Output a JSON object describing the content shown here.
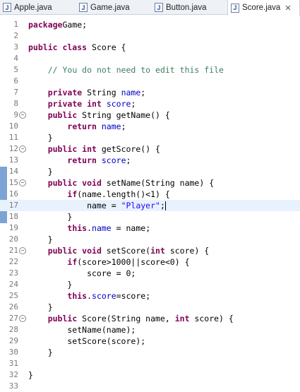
{
  "tabs": [
    {
      "label": "Apple.java",
      "active": false
    },
    {
      "label": "Game.java",
      "active": false
    },
    {
      "label": "Button.java",
      "active": false
    },
    {
      "label": "Score.java",
      "active": true
    }
  ],
  "current_line": 17,
  "lines": [
    {
      "n": "1",
      "fold": false,
      "t": [
        [
          "kw",
          "package"
        ],
        [
          "",
          "Game;"
        ]
      ]
    },
    {
      "n": "2",
      "fold": false,
      "t": []
    },
    {
      "n": "3",
      "fold": false,
      "t": [
        [
          "kw",
          "public class"
        ],
        [
          "",
          " Score {"
        ]
      ]
    },
    {
      "n": "4",
      "fold": false,
      "t": []
    },
    {
      "n": "5",
      "fold": false,
      "t": [
        [
          "",
          "    "
        ],
        [
          "cm",
          "// You do not need to edit this file"
        ]
      ]
    },
    {
      "n": "6",
      "fold": false,
      "t": []
    },
    {
      "n": "7",
      "fold": false,
      "t": [
        [
          "",
          "    "
        ],
        [
          "kw",
          "private"
        ],
        [
          "",
          " String "
        ],
        [
          "fld",
          "name"
        ],
        [
          "",
          ";"
        ]
      ]
    },
    {
      "n": "8",
      "fold": false,
      "t": [
        [
          "",
          "    "
        ],
        [
          "kw",
          "private int"
        ],
        [
          "",
          " "
        ],
        [
          "fld",
          "score"
        ],
        [
          "",
          ";"
        ]
      ]
    },
    {
      "n": "9",
      "fold": true,
      "t": [
        [
          "",
          "    "
        ],
        [
          "kw",
          "public"
        ],
        [
          "",
          " String getName() {"
        ]
      ]
    },
    {
      "n": "10",
      "fold": false,
      "t": [
        [
          "",
          "        "
        ],
        [
          "kw",
          "return"
        ],
        [
          "",
          " "
        ],
        [
          "fld",
          "name"
        ],
        [
          "",
          ";"
        ]
      ]
    },
    {
      "n": "11",
      "fold": false,
      "t": [
        [
          "",
          "    }"
        ]
      ]
    },
    {
      "n": "12",
      "fold": true,
      "t": [
        [
          "",
          "    "
        ],
        [
          "kw",
          "public int"
        ],
        [
          "",
          " getScore() {"
        ]
      ]
    },
    {
      "n": "13",
      "fold": false,
      "t": [
        [
          "",
          "        "
        ],
        [
          "kw",
          "return"
        ],
        [
          "",
          " "
        ],
        [
          "fld",
          "score"
        ],
        [
          "",
          ";"
        ]
      ]
    },
    {
      "n": "14",
      "fold": false,
      "t": [
        [
          "",
          "    }"
        ]
      ]
    },
    {
      "n": "15",
      "fold": true,
      "t": [
        [
          "",
          "    "
        ],
        [
          "kw",
          "public void"
        ],
        [
          "",
          " setName(String name) {"
        ]
      ]
    },
    {
      "n": "16",
      "fold": false,
      "t": [
        [
          "",
          "        "
        ],
        [
          "kw",
          "if"
        ],
        [
          "",
          "(name.length()<1) {"
        ]
      ]
    },
    {
      "n": "17",
      "fold": false,
      "t": [
        [
          "",
          "            name = "
        ],
        [
          "str",
          "\"Player\""
        ],
        [
          "",
          ";"
        ]
      ]
    },
    {
      "n": "18",
      "fold": false,
      "t": [
        [
          "",
          "        }"
        ]
      ]
    },
    {
      "n": "19",
      "fold": false,
      "t": [
        [
          "",
          "        "
        ],
        [
          "kw",
          "this"
        ],
        [
          "",
          "."
        ],
        [
          "fld",
          "name"
        ],
        [
          "",
          " = name;"
        ]
      ]
    },
    {
      "n": "20",
      "fold": false,
      "t": [
        [
          "",
          "    }"
        ]
      ]
    },
    {
      "n": "21",
      "fold": true,
      "t": [
        [
          "",
          "    "
        ],
        [
          "kw",
          "public void"
        ],
        [
          "",
          " setScore("
        ],
        [
          "kw",
          "int"
        ],
        [
          "",
          " score) {"
        ]
      ]
    },
    {
      "n": "22",
      "fold": false,
      "t": [
        [
          "",
          "        "
        ],
        [
          "kw",
          "if"
        ],
        [
          "",
          "(score>1000||score<0) {"
        ]
      ]
    },
    {
      "n": "23",
      "fold": false,
      "t": [
        [
          "",
          "            score = 0;"
        ]
      ]
    },
    {
      "n": "24",
      "fold": false,
      "t": [
        [
          "",
          "        }"
        ]
      ]
    },
    {
      "n": "25",
      "fold": false,
      "t": [
        [
          "",
          "        "
        ],
        [
          "kw",
          "this"
        ],
        [
          "",
          "."
        ],
        [
          "fld",
          "score"
        ],
        [
          "",
          "=score;"
        ]
      ]
    },
    {
      "n": "26",
      "fold": false,
      "t": [
        [
          "",
          "    }"
        ]
      ]
    },
    {
      "n": "27",
      "fold": true,
      "t": [
        [
          "",
          "    "
        ],
        [
          "kw",
          "public"
        ],
        [
          "",
          " Score(String name, "
        ],
        [
          "kw",
          "int"
        ],
        [
          "",
          " score) {"
        ]
      ]
    },
    {
      "n": "28",
      "fold": false,
      "t": [
        [
          "",
          "        setName(name);"
        ]
      ]
    },
    {
      "n": "29",
      "fold": false,
      "t": [
        [
          "",
          "        setScore(score);"
        ]
      ]
    },
    {
      "n": "30",
      "fold": false,
      "t": [
        [
          "",
          "    }"
        ]
      ]
    },
    {
      "n": "31",
      "fold": false,
      "t": []
    },
    {
      "n": "32",
      "fold": false,
      "t": [
        [
          "",
          "}"
        ]
      ]
    },
    {
      "n": "33",
      "fold": false,
      "t": []
    }
  ],
  "icons": {
    "file": "java-file-icon",
    "close": "close-icon",
    "fold": "fold-collapse-icon"
  }
}
